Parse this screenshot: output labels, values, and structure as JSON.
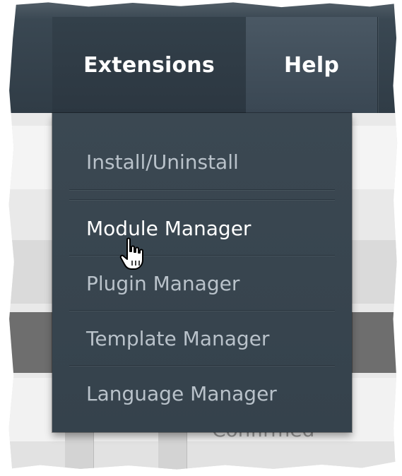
{
  "topnav": {
    "items": [
      {
        "label": "Extensions",
        "state": "open"
      },
      {
        "label": "Help"
      }
    ]
  },
  "extensions_menu": {
    "items": [
      {
        "label": "Install/Uninstall"
      },
      {
        "label": "Module Manager",
        "state": "hover"
      },
      {
        "label": "Plugin Manager"
      },
      {
        "label": "Template Manager"
      },
      {
        "label": "Language Manager"
      }
    ]
  },
  "background": {
    "status_text": "Confirmed"
  },
  "colors": {
    "nav_bg": "#34414b",
    "menu_bg": "#38454f",
    "menu_text": "#b9c2ca",
    "menu_text_active": "#ffffff"
  },
  "icons": {
    "cursor": "hand-pointer-icon"
  }
}
